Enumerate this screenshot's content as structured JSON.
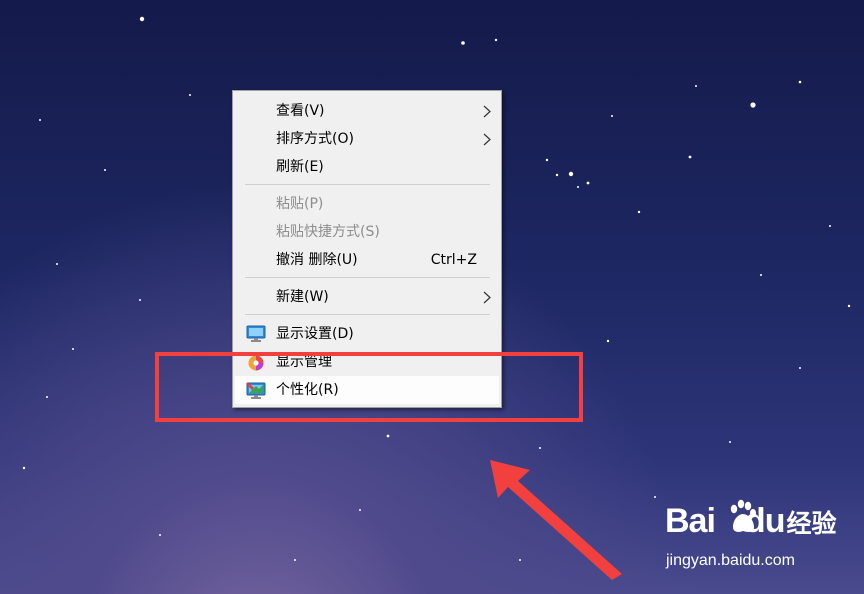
{
  "context_menu": {
    "items": [
      {
        "label": "查看(V)",
        "submenu": true
      },
      {
        "label": "排序方式(O)",
        "submenu": true
      },
      {
        "label": "刷新(E)"
      },
      {
        "label": "粘贴(P)",
        "disabled": true
      },
      {
        "label": "粘贴快捷方式(S)",
        "disabled": true
      },
      {
        "label": "撤消 删除(U)",
        "shortcut": "Ctrl+Z"
      },
      {
        "label": "新建(W)",
        "submenu": true
      },
      {
        "label": "显示设置(D)",
        "icon": "display-settings-icon"
      },
      {
        "label": "显示管理",
        "icon": "display-manager-icon"
      },
      {
        "label": "个性化(R)",
        "icon": "personalize-icon",
        "highlighted": true
      }
    ]
  },
  "annotation": {
    "box_color": "#f1403e",
    "arrow_color": "#f1403e"
  },
  "watermark": {
    "brand": "Bai",
    "brand_tail": "du",
    "suffix": "经验",
    "url": "jingyan.baidu.com"
  }
}
